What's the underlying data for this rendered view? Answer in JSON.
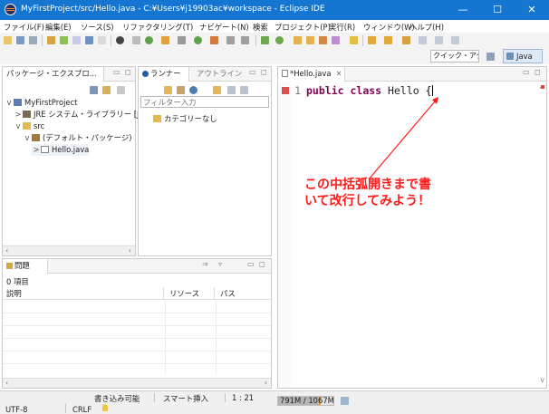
{
  "window": {
    "title": "MyFirstProject/src/Hello.java - C:¥Users¥j19903ac¥workspace - Eclipse IDE",
    "controls": [
      "—",
      "☐",
      "✕"
    ]
  },
  "menu": [
    "ファイル(F)",
    "編集(E)",
    "ソース(S)",
    "リファクタリング(T)",
    "ナビゲート(N)",
    "検索",
    "プロジェクト(P)",
    "実行(R)",
    "ウィンドウ(W)",
    "ヘルプ(H)"
  ],
  "toolbar": {
    "quick_access": "クイック・アクセス",
    "perspective": "Java"
  },
  "package_explorer": {
    "tab_label": "パッケージ・エクスプロ...",
    "tree": [
      {
        "label": "MyFirstProject",
        "twisty": "v"
      },
      {
        "label": "JRE システム・ライブラリー [Java",
        "twisty": ">"
      },
      {
        "label": "src",
        "twisty": "v"
      },
      {
        "label": "(デフォルト・パッケージ)",
        "twisty": "v"
      },
      {
        "label": "Hello.java",
        "twisty": ">"
      }
    ]
  },
  "task_panel": {
    "tab_runner": "ランナー",
    "tab_outline": "アウトライン",
    "filter_placeholder": "フィルター入力",
    "category": "カテゴリーなし"
  },
  "editor": {
    "tab_label": "*Hello.java",
    "line_number": "1",
    "keyword_public": "public",
    "keyword_class": "class",
    "class_name": "Hello",
    "brace": "{"
  },
  "annotation": {
    "line1": "この中括弧開きまで書",
    "line2": "いて改行してみよう！",
    "color": "#ff1a1a"
  },
  "problems": {
    "tab_label": "問題",
    "summary": "0 項目",
    "columns": [
      "説明",
      "リソース",
      "パス"
    ]
  },
  "status": {
    "writable": "書き込み可能",
    "insert_mode": "スマート挿入",
    "position": "1 : 21",
    "heap": "791M / 1067M",
    "heap_used_fraction": 0.741,
    "encoding": "UTF-8",
    "line_delimiter": "CRLF"
  }
}
